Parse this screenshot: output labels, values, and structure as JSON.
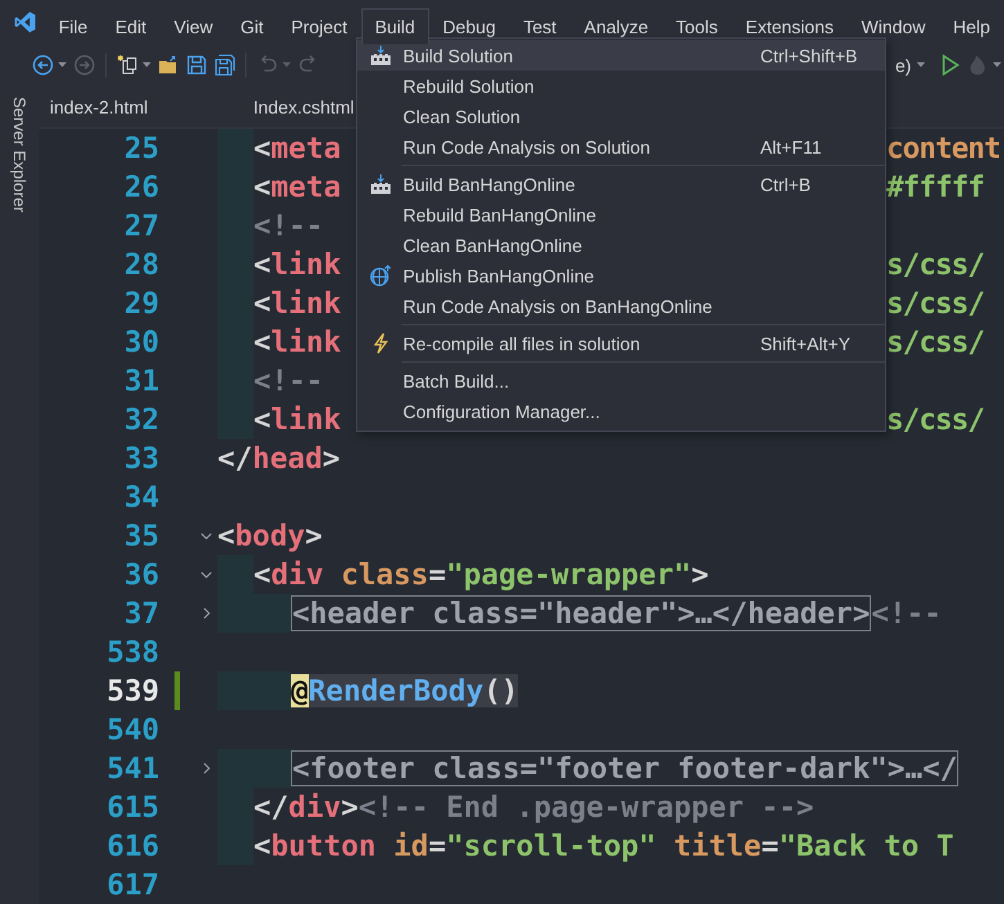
{
  "menubar": [
    {
      "label": "File",
      "selected": false
    },
    {
      "label": "Edit",
      "selected": false
    },
    {
      "label": "View",
      "selected": false
    },
    {
      "label": "Git",
      "selected": false
    },
    {
      "label": "Project",
      "selected": false
    },
    {
      "label": "Build",
      "selected": true
    },
    {
      "label": "Debug",
      "selected": false
    },
    {
      "label": "Test",
      "selected": false
    },
    {
      "label": "Analyze",
      "selected": false
    },
    {
      "label": "Tools",
      "selected": false
    },
    {
      "label": "Extensions",
      "selected": false
    },
    {
      "label": "Window",
      "selected": false
    },
    {
      "label": "Help",
      "selected": false
    }
  ],
  "toolbar": {
    "config_text": "e)"
  },
  "side_panel": {
    "label": "Server Explorer"
  },
  "tabs": [
    {
      "label": "index-2.html"
    },
    {
      "label": "Index.cshtml"
    }
  ],
  "build_menu": [
    {
      "kind": "build",
      "label": "Build Solution",
      "shortcut": "Ctrl+Shift+B",
      "highlighted": true
    },
    {
      "kind": "plain",
      "label": "Rebuild Solution",
      "highlighted": false
    },
    {
      "kind": "plain",
      "label": "Clean Solution",
      "highlighted": false
    },
    {
      "kind": "plain",
      "label": "Run Code Analysis on Solution",
      "shortcut": "Alt+F11",
      "highlighted": false
    },
    {
      "kind": "separator"
    },
    {
      "kind": "build",
      "label": "Build BanHangOnline",
      "shortcut": "Ctrl+B",
      "highlighted": false
    },
    {
      "kind": "plain",
      "label": "Rebuild BanHangOnline",
      "highlighted": false
    },
    {
      "kind": "plain",
      "label": "Clean BanHangOnline",
      "highlighted": false
    },
    {
      "kind": "publish",
      "label": "Publish BanHangOnline",
      "highlighted": false
    },
    {
      "kind": "plain",
      "label": "Run Code Analysis on BanHangOnline",
      "highlighted": false
    },
    {
      "kind": "separator"
    },
    {
      "kind": "recompile",
      "label": "Re-compile all files in solution",
      "shortcut": "Shift+Alt+Y",
      "highlighted": false
    },
    {
      "kind": "separator"
    },
    {
      "kind": "plain",
      "label": "Batch Build...",
      "highlighted": false
    },
    {
      "kind": "plain",
      "label": "Configuration Manager...",
      "highlighted": false
    }
  ],
  "editor": [
    {
      "number": "25",
      "kind": "indented",
      "tokens": [
        {
          "kind": "punct",
          "text": "<"
        },
        {
          "kind": "tag",
          "text": "meta"
        }
      ],
      "right": [
        {
          "kind": "attr",
          "text": "content"
        }
      ]
    },
    {
      "number": "26",
      "kind": "indented",
      "tokens": [
        {
          "kind": "punct",
          "text": "<"
        },
        {
          "kind": "tag",
          "text": "meta"
        }
      ],
      "right": [
        {
          "kind": "str",
          "text": "#fffff"
        }
      ]
    },
    {
      "number": "27",
      "kind": "indented",
      "tokens": [
        {
          "kind": "comment",
          "text": "<!--"
        }
      ]
    },
    {
      "number": "28",
      "kind": "indented",
      "tokens": [
        {
          "kind": "punct",
          "text": "<"
        },
        {
          "kind": "tag",
          "text": "link"
        }
      ],
      "right": [
        {
          "kind": "str",
          "text": "s/css/"
        }
      ]
    },
    {
      "number": "29",
      "kind": "indented",
      "tokens": [
        {
          "kind": "punct",
          "text": "<"
        },
        {
          "kind": "tag",
          "text": "link"
        }
      ],
      "right": [
        {
          "kind": "str",
          "text": "s/css/"
        }
      ]
    },
    {
      "number": "30",
      "kind": "indented",
      "tokens": [
        {
          "kind": "punct",
          "text": "<"
        },
        {
          "kind": "tag",
          "text": "link"
        }
      ],
      "right": [
        {
          "kind": "str",
          "text": "s/css/"
        }
      ]
    },
    {
      "number": "31",
      "kind": "indented",
      "tokens": [
        {
          "kind": "comment",
          "text": "<!--"
        }
      ]
    },
    {
      "number": "32",
      "kind": "indented",
      "tokens": [
        {
          "kind": "punct",
          "text": "<"
        },
        {
          "kind": "tag",
          "text": "link"
        }
      ],
      "right": [
        {
          "kind": "str",
          "text": "s/css/"
        }
      ]
    },
    {
      "number": "33",
      "kind": "flush",
      "tokens": [
        {
          "kind": "punct",
          "text": "</"
        },
        {
          "kind": "tag",
          "text": "head"
        },
        {
          "kind": "punct",
          "text": ">"
        }
      ]
    },
    {
      "number": "34",
      "kind": "flush"
    },
    {
      "number": "35",
      "kind": "flush",
      "expanded": true,
      "tokens": [
        {
          "kind": "punct",
          "text": "<"
        },
        {
          "kind": "tag",
          "text": "body"
        },
        {
          "kind": "punct",
          "text": ">"
        }
      ]
    },
    {
      "number": "36",
      "kind": "indented",
      "expanded": true,
      "tokens": [
        {
          "kind": "punct",
          "text": "<"
        },
        {
          "kind": "tag",
          "text": "div"
        },
        {
          "kind": "attr",
          "text": " class"
        },
        {
          "kind": "punct",
          "text": "="
        },
        {
          "kind": "str",
          "text": "\"page-wrapper\""
        },
        {
          "kind": "punct",
          "text": ">"
        }
      ]
    },
    {
      "number": "37",
      "kind": "nested",
      "expanded": false,
      "tokens": [
        {
          "kind": "collapsed",
          "text": "<header class=\"header\">…</header>"
        },
        {
          "kind": "comment",
          "text": "<!--"
        }
      ]
    },
    {
      "number": "538",
      "kind": "flush"
    },
    {
      "number": "539",
      "kind": "nested",
      "current": true,
      "changed": true,
      "tokens": [
        {
          "kind": "razor",
          "text": "@"
        },
        {
          "kind": "method",
          "text": "RenderBody"
        },
        {
          "kind": "paren",
          "text": "()"
        }
      ]
    },
    {
      "number": "540",
      "kind": "flush"
    },
    {
      "number": "541",
      "kind": "nested",
      "expanded": false,
      "tokens": [
        {
          "kind": "collapsed",
          "text": "<footer class=\"footer footer-dark\">…</"
        }
      ]
    },
    {
      "number": "615",
      "kind": "indented",
      "tokens": [
        {
          "kind": "punct",
          "text": "</"
        },
        {
          "kind": "tag",
          "text": "div"
        },
        {
          "kind": "punct",
          "text": ">"
        },
        {
          "kind": "comment",
          "text": "<!-- End .page-wrapper -->"
        }
      ]
    },
    {
      "number": "616",
      "kind": "indented",
      "tokens": [
        {
          "kind": "punct",
          "text": "<"
        },
        {
          "kind": "tag",
          "text": "button"
        },
        {
          "kind": "attr",
          "text": " id"
        },
        {
          "kind": "punct",
          "text": "="
        },
        {
          "kind": "str",
          "text": "\"scroll-top\""
        },
        {
          "kind": "attr",
          "text": " title"
        },
        {
          "kind": "punct",
          "text": "="
        },
        {
          "kind": "str",
          "text": "\"Back to T"
        }
      ]
    },
    {
      "number": "617",
      "kind": "flush"
    }
  ]
}
